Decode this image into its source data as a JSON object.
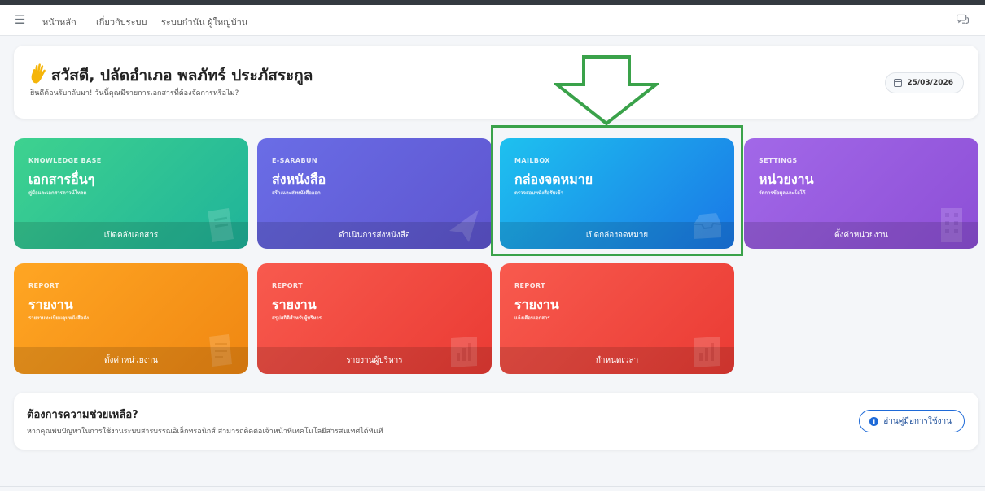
{
  "navbar": {
    "menu_icon": "hamburger-icon",
    "links": [
      "หน้าหลัก",
      "เกี่ยวกับระบบ",
      "ระบบกำนัน ผู้ใหญ่บ้าน"
    ],
    "chat_icon": "chat-icon"
  },
  "welcome": {
    "icon": "waving-hand-icon",
    "title": "สวัสดี, ปลัดอำเภอ พลภัทร์ ประภัสระกูล",
    "subtitle": "ยินดีต้อนรับกลับมา! วันนี้คุณมีรายการเอกสารที่ต้องจัดการหรือไม่?",
    "date": "25/03/2026"
  },
  "cards": [
    {
      "category": "KNOWLEDGE BASE",
      "title": "เอกสารอื่นๆ",
      "desc": "คู่มือและเอกสารดาวน์โหลด",
      "button": "เปิดคลังเอกสาร",
      "icon": "document-icon",
      "gradient": [
        "#3ed28f",
        "#1fb39a"
      ]
    },
    {
      "category": "E-SARABUN",
      "title": "ส่งหนังสือ",
      "desc": "สร้างและส่งหนังสือออก",
      "button": "ดำเนินการส่งหนังสือ",
      "icon": "paper-plane-icon",
      "gradient": [
        "#6a6de6",
        "#5e55cf"
      ]
    },
    {
      "category": "MAILBOX",
      "title": "กล่องจดหมาย",
      "desc": "ตรวจสอบหนังสือรับเข้า",
      "button": "เปิดกล่องจดหมาย",
      "icon": "inbox-icon",
      "gradient": [
        "#1ec1ef",
        "#1a77e6"
      ]
    },
    {
      "category": "SETTINGS",
      "title": "หน่วยงาน",
      "desc": "จัดการข้อมูลและโลโก้",
      "button": "ตั้งค่าหน่วยงาน",
      "icon": "building-icon",
      "gradient": [
        "#a268e8",
        "#8d4fd6"
      ]
    },
    {
      "category": "REPORT",
      "title": "รายงาน",
      "desc": "รายงานทะเบียนคุมหนังสือส่ง",
      "button": "ตั้งค่าหน่วยงาน",
      "icon": "report-icon",
      "gradient": [
        "#ffa623",
        "#f08712"
      ]
    },
    {
      "category": "REPORT",
      "title": "รายงาน",
      "desc": "สรุปสถิติสำหรับผู้บริหาร",
      "button": "รายงานผู้บริหาร",
      "icon": "chart-icon",
      "gradient": [
        "#f85a4e",
        "#ea3b34"
      ]
    },
    {
      "category": "REPORT",
      "title": "รายงาน",
      "desc": "แจ้งเตือนเอกสาร",
      "button": "กำหนดเวลา",
      "icon": "chart-icon",
      "gradient": [
        "#f85a4e",
        "#ea3b34"
      ]
    }
  ],
  "help": {
    "title": "ต้องการความช่วยเหลือ?",
    "subtitle": "หากคุณพบปัญหาในการใช้งานระบบสารบรรณอิเล็กทรอนิกส์ สามารถติดต่อเจ้าหน้าที่เทคโนโลยีสารสนเทศได้ทันที",
    "button": "อ่านคู่มือการใช้งาน"
  },
  "annotation": {
    "arrow_color": "#3aa24a",
    "highlight_target": "MAILBOX"
  }
}
